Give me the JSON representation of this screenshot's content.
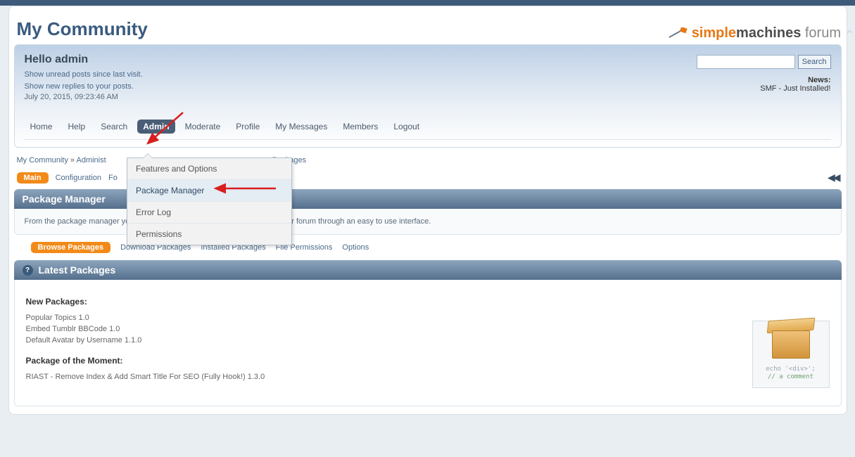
{
  "site": {
    "title": "My Community"
  },
  "logo": {
    "orange": "simple",
    "dark": "machines",
    "light": " forum"
  },
  "header": {
    "hello": "Hello admin",
    "unread_link": "Show unread posts since last visit.",
    "replies_link": "Show new replies to your posts.",
    "timestamp": "July 20, 2015, 09:23:46 AM",
    "news_label": "News:",
    "news_text": "SMF - Just Installed!",
    "search_button": "Search"
  },
  "nav": {
    "items": [
      "Home",
      "Help",
      "Search",
      "Admin",
      "Moderate",
      "Profile",
      "My Messages",
      "Members",
      "Logout"
    ],
    "active_index": 3
  },
  "dropdown": {
    "items": [
      "Features and Options",
      "Package Manager",
      "Error Log",
      "Permissions"
    ],
    "hover_index": 1
  },
  "breadcrumb": {
    "parts": [
      "My Community",
      "Administ",
      "Packages"
    ],
    "sep": " » "
  },
  "admin_tabs": {
    "active": "Main",
    "others": [
      "Configuration",
      "Fo"
    ]
  },
  "section": {
    "title": "Package Manager",
    "info": "From the package manager you can download and install modifications to your forum through an easy to use interface."
  },
  "pm_tabs": {
    "active": "Browse Packages",
    "others": [
      "Download Packages",
      "Installed Packages",
      "File Permissions",
      "Options"
    ]
  },
  "latest": {
    "title": "Latest Packages",
    "new_heading": "New Packages:",
    "new_items": [
      "Popular Topics 1.0",
      "Embed Tumblr BBCode 1.0",
      "Default Avatar by Username 1.1.0"
    ],
    "moment_heading": "Package of the Moment:",
    "moment_item": "RIAST - Remove Index & Add Smart Title For SEO (Fully Hook!) 1.3.0",
    "thumb_code1": "echo '<div>';",
    "thumb_code2": "// a comment"
  },
  "icons": {
    "rewind": "◀◀"
  }
}
